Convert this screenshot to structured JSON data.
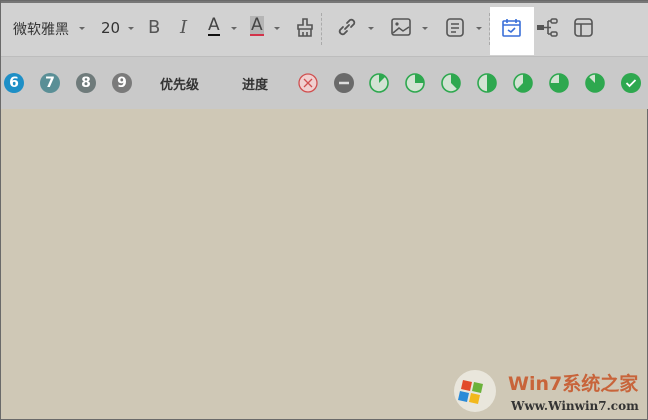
{
  "toolbar": {
    "font_family": "微软雅黑",
    "font_size": "20",
    "bold_label": "B",
    "italic_label": "I",
    "font_color_label": "A",
    "highlight_label": "A"
  },
  "markers": {
    "priority_numbers": [
      "6",
      "7",
      "8",
      "9"
    ],
    "priority_label": "优先级",
    "progress_label": "进度",
    "progress_levels": [
      0.125,
      0.25,
      0.375,
      0.5,
      0.625,
      0.75,
      0.875,
      1
    ]
  },
  "colors": {
    "green": "#2ea84f",
    "blue": "#1e8fc6",
    "teal": "#5a8f96",
    "gray": "#6f7b7b",
    "accent": "#3a6fd8"
  },
  "watermark": {
    "title": "Win7系统之家",
    "url": "Www.Winwin7.com"
  }
}
